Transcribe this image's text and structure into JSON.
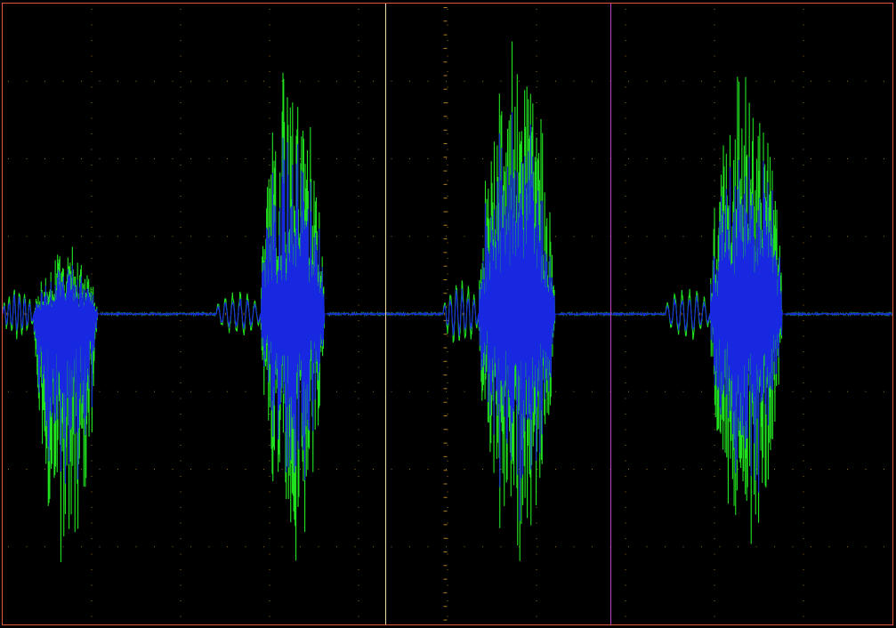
{
  "colors": {
    "background": "#000000",
    "frame": "#e0573f",
    "graticule": "#b8862a",
    "cursor_a": "#f0d8a8",
    "cursor_b": "#c040c8",
    "trace_back": "#20e020",
    "trace_front": "#1828e0"
  },
  "chart_data": {
    "type": "line",
    "title": "",
    "xlabel": "",
    "ylabel": "",
    "xlim": [
      0,
      10
    ],
    "ylim": [
      -4,
      4
    ],
    "grid": true,
    "grid_divisions": {
      "x": 10,
      "y": 8
    },
    "cursors": [
      {
        "name": "",
        "x": 4.3
      },
      {
        "name": "",
        "x": 6.83
      }
    ],
    "bursts": [
      {
        "pre_start": 0.0,
        "pre_end": 0.35,
        "start": 0.35,
        "end": 1.1,
        "pre_amp": 0.35,
        "peak_pos": [
          0.55,
          0.95
        ],
        "peak_neg": [
          -2.7,
          -3.4
        ],
        "seed": 11
      },
      {
        "pre_start": 2.4,
        "pre_end": 2.9,
        "start": 2.9,
        "end": 3.65,
        "pre_amp": 0.3,
        "peak_pos": [
          2.7,
          3.4
        ],
        "peak_neg": [
          -2.6,
          -3.5
        ],
        "seed": 23
      },
      {
        "pre_start": 4.95,
        "pre_end": 5.35,
        "start": 5.35,
        "end": 6.25,
        "pre_amp": 0.45,
        "peak_pos": [
          2.8,
          3.8
        ],
        "peak_neg": [
          -2.5,
          -3.4
        ],
        "seed": 37
      },
      {
        "pre_start": 7.45,
        "pre_end": 7.95,
        "start": 7.95,
        "end": 8.8,
        "pre_amp": 0.35,
        "peak_pos": [
          2.8,
          3.6
        ],
        "peak_neg": [
          -2.7,
          -3.3
        ],
        "seed": 51
      }
    ],
    "series": [
      {
        "name": "",
        "color_key": "trace_back",
        "amplitude_scale": 1.0
      },
      {
        "name": "",
        "color_key": "trace_front",
        "amplitude_scale": 0.72
      }
    ]
  }
}
